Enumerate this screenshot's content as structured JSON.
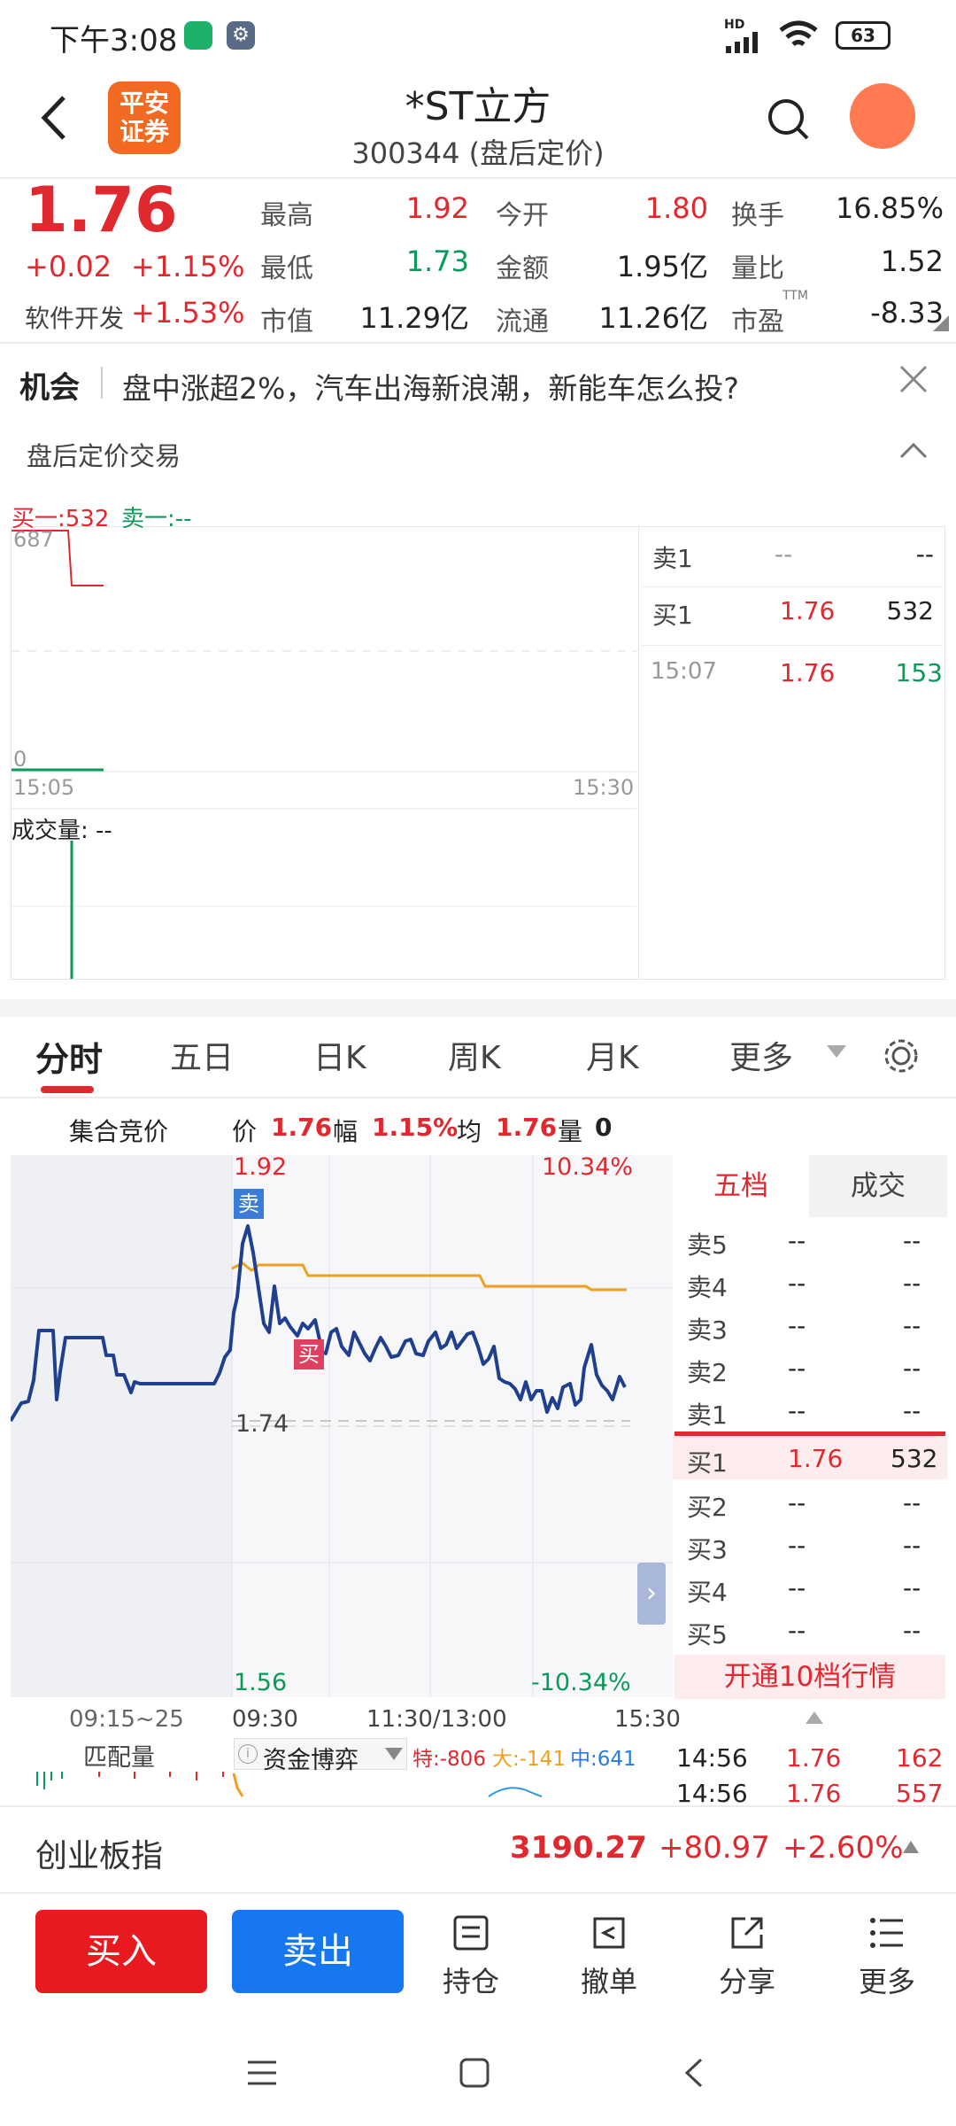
{
  "status": {
    "time": "下午3:08",
    "battery": "63",
    "net_label": "HD"
  },
  "header": {
    "title": "*ST立方",
    "subtitle": "300344 (盘后定价)",
    "logo_text": "平安\n证券"
  },
  "quote": {
    "price": "1.76",
    "change": "+0.02",
    "change_pct": "+1.15%",
    "sector_label": "软件开发",
    "sector_pct": "+1.53%",
    "high_label": "最高",
    "high": "1.92",
    "open_label": "今开",
    "open": "1.80",
    "turnover_label": "换手",
    "turnover": "16.85%",
    "low_label": "最低",
    "low": "1.73",
    "amount_label": "金额",
    "amount": "1.95亿",
    "ratio_label": "量比",
    "ratio": "1.52",
    "mcap_label": "市值",
    "mcap": "11.29亿",
    "float_label": "流通",
    "float": "11.26亿",
    "pe_label": "市盈",
    "pe_sup": "TTM",
    "pe": "-8.33"
  },
  "banner": {
    "tag": "机会",
    "text": "盘中涨超2%，汽车出海新浪潮，新能车怎么投?"
  },
  "after_hours": {
    "title": "盘后定价交易",
    "buy1_label": "买一:532",
    "sell1_label": "卖一:--",
    "y_top": "687",
    "y_bottom": "0",
    "x_start": "15:05",
    "x_end": "15:30",
    "volume_label": "成交量: --",
    "book": [
      {
        "side": "卖1",
        "price": "--",
        "qty": "--"
      },
      {
        "side": "买1",
        "price": "1.76",
        "qty": "532"
      }
    ],
    "trade": {
      "time": "15:07",
      "price": "1.76",
      "qty": "153"
    }
  },
  "tabs": [
    {
      "label": "分时",
      "active": true
    },
    {
      "label": "五日"
    },
    {
      "label": "日K"
    },
    {
      "label": "周K"
    },
    {
      "label": "月K"
    },
    {
      "label": "更多"
    }
  ],
  "intraday_info": {
    "auction_label": "集合竞价",
    "price_label": "价",
    "price": "1.76",
    "range_label": "幅",
    "range": "1.15%",
    "avg_label": "均",
    "avg": "1.76",
    "vol_label": "量",
    "vol": "0"
  },
  "intraday": {
    "y_high": "1.92",
    "y_high_pct": "10.34%",
    "y_mid": "1.74",
    "y_low": "1.56",
    "y_low_pct": "-10.34%",
    "x_labels": [
      "09:15~25",
      "09:30",
      "11:30/13:00",
      "15:30"
    ],
    "sell_marker": "卖",
    "buy_marker": "买",
    "sub_label": "匹配量",
    "sub_indicator": "资金博弈",
    "sub_te": "特:-806",
    "sub_da": "大:-141",
    "sub_zhong": "中:641"
  },
  "order_book": {
    "tab_five": "五档",
    "tab_trades": "成交",
    "asks": [
      {
        "label": "卖5",
        "price": "--",
        "qty": "--"
      },
      {
        "label": "卖4",
        "price": "--",
        "qty": "--"
      },
      {
        "label": "卖3",
        "price": "--",
        "qty": "--"
      },
      {
        "label": "卖2",
        "price": "--",
        "qty": "--"
      },
      {
        "label": "卖1",
        "price": "--",
        "qty": "--"
      }
    ],
    "bids": [
      {
        "label": "买1",
        "price": "1.76",
        "qty": "532"
      },
      {
        "label": "买2",
        "price": "--",
        "qty": "--"
      },
      {
        "label": "买3",
        "price": "--",
        "qty": "--"
      },
      {
        "label": "买4",
        "price": "--",
        "qty": "--"
      },
      {
        "label": "买5",
        "price": "--",
        "qty": "--"
      }
    ],
    "upgrade_label": "开通10档行情",
    "ticks": [
      {
        "time": "14:56",
        "price": "1.76",
        "qty": "162"
      },
      {
        "time": "14:56",
        "price": "1.76",
        "qty": "557"
      }
    ]
  },
  "index_bar": {
    "name": "创业板指",
    "value": "3190.27",
    "change": "+80.97",
    "pct": "+2.60%"
  },
  "toolbar": {
    "buy": "买入",
    "sell": "卖出",
    "positions": "持仓",
    "cancel": "撤单",
    "share": "分享",
    "more": "更多"
  },
  "colors": {
    "red": "#e0282f",
    "green": "#0a9a5a",
    "blue_line": "#1f3f8f",
    "avg_line": "#f0a020",
    "buy_btn": "#e8191f",
    "sell_btn": "#1677f0"
  }
}
